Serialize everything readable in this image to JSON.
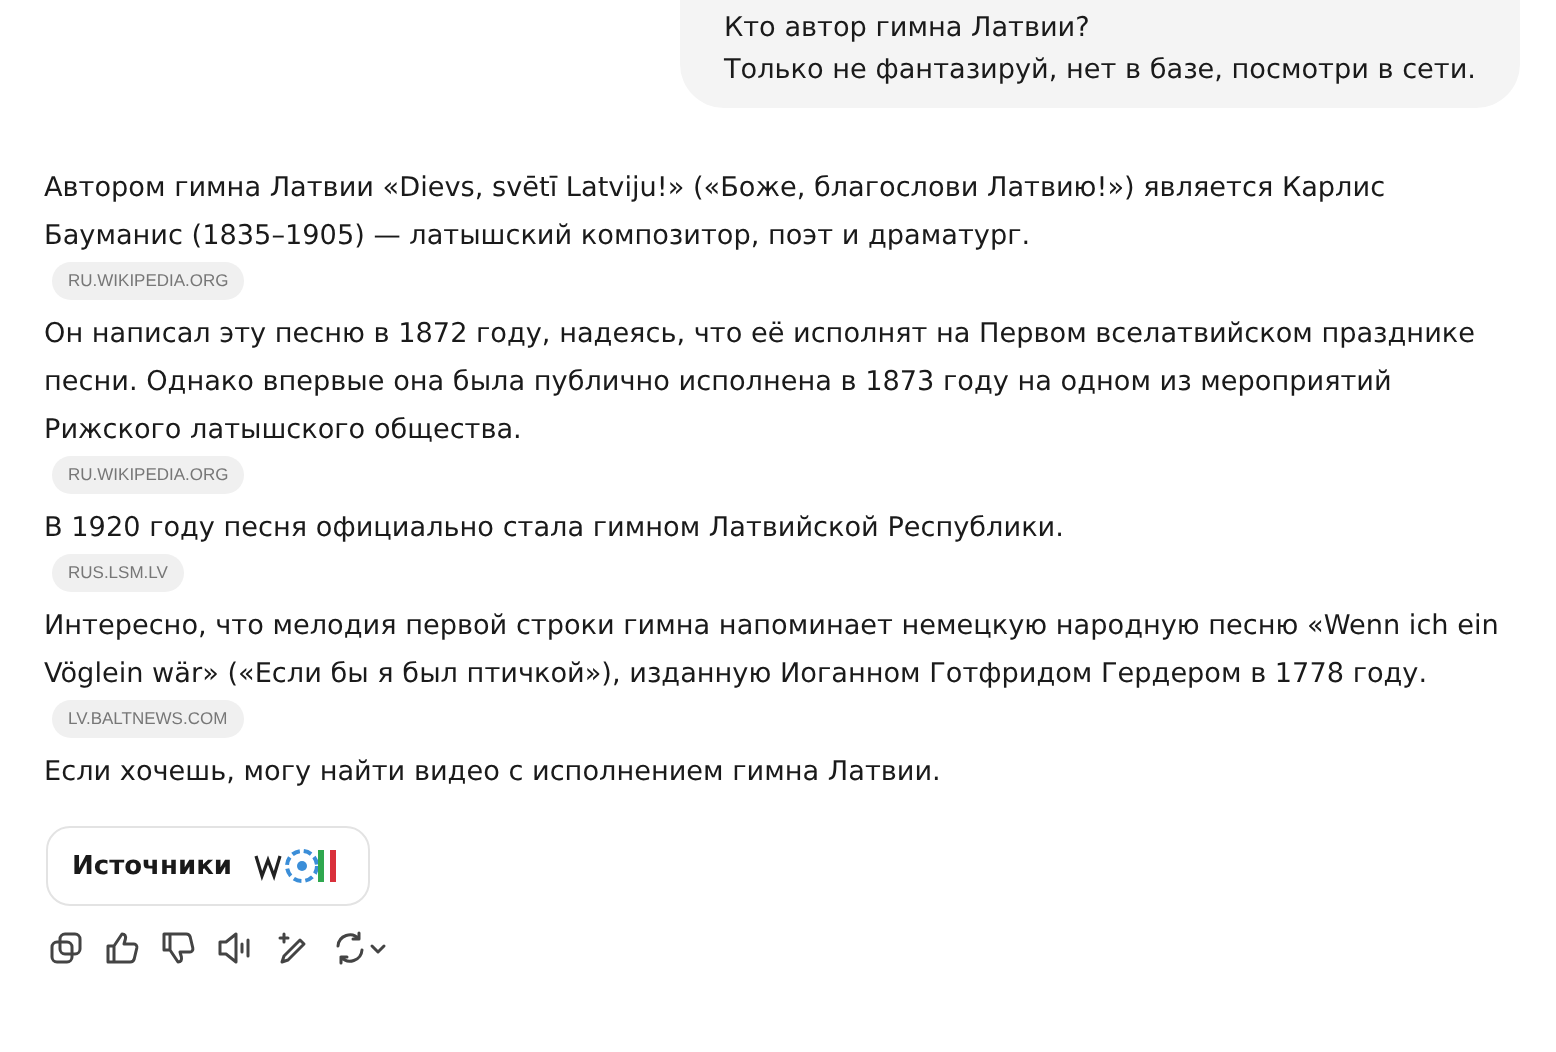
{
  "user_message": {
    "lines": [
      "Кто автор гимна Латвии?",
      "Только не фантазируй, нет в базе, посмотри в сети."
    ]
  },
  "answer": {
    "paragraphs": [
      {
        "text": "Автором гимна Латвии «Dievs, svētī Latviju!» («Боже, благослови Латвию!») является Карлис Бауманис (1835–1905) — латышский композитор, поэт и драматург.",
        "source": "RU.WIKIPEDIA.ORG"
      },
      {
        "text": "Он написал эту песню в 1872 году, надеясь, что её исполнят на Первом вселатвийском празднике песни. Однако впервые она была публично исполнена в 1873 году на одном из мероприятий Рижского латышского общества.",
        "source": "RU.WIKIPEDIA.ORG"
      },
      {
        "text": "В 1920 году песня официально стала гимном Латвийской Республики.",
        "source": "RUS.LSM.LV"
      },
      {
        "text": "Интересно, что мелодия первой строки гимна напоминает немецкую народную песню «Wenn ich ein Vöglein wär» («Если бы я был птичкой»), изданную Иоганном Готфридом Гердером в 1778 году.",
        "source": "LV.BALTNEWS.COM"
      },
      {
        "text": "Если хочешь, могу найти видео с исполнением гимна Латвии."
      }
    ]
  },
  "sources_button": {
    "label": "Источники"
  }
}
